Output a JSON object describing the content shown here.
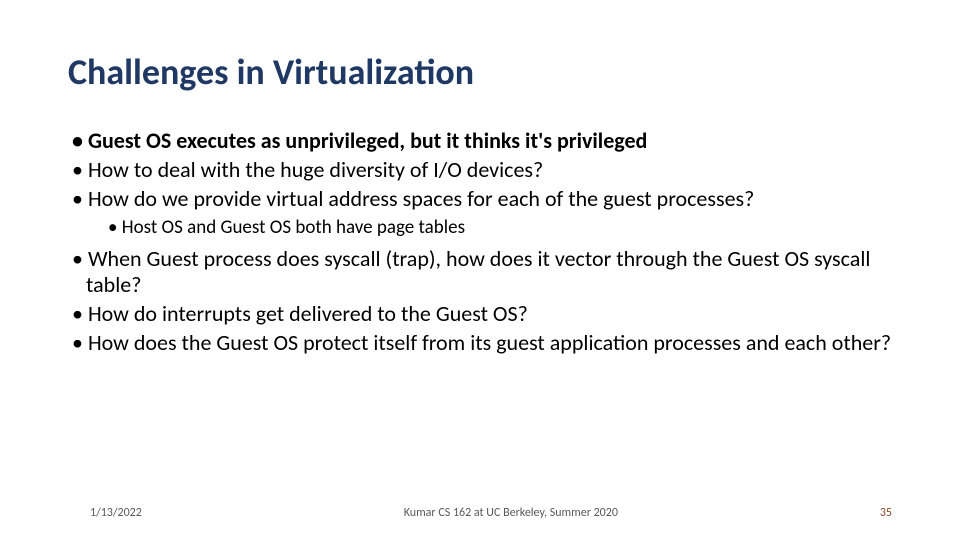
{
  "title": "Challenges in Virtualization",
  "bullets": {
    "b1": "Guest OS executes as unprivileged, but it thinks it's privileged",
    "b2": "How to deal with the huge diversity of I/O devices?",
    "b3": "How do we provide virtual address spaces for each of the guest processes?",
    "b3a": "Host OS and Guest OS both have page tables",
    "b4": "When Guest process does syscall (trap), how does it vector through the Guest OS syscall table?",
    "b5": "How do interrupts get delivered to the Guest OS?",
    "b6": "How does the Guest OS protect itself from its guest application processes and each other?"
  },
  "footer": {
    "date": "1/13/2022",
    "center": "Kumar CS 162 at UC Berkeley, Summer 2020",
    "pageno": "35"
  }
}
